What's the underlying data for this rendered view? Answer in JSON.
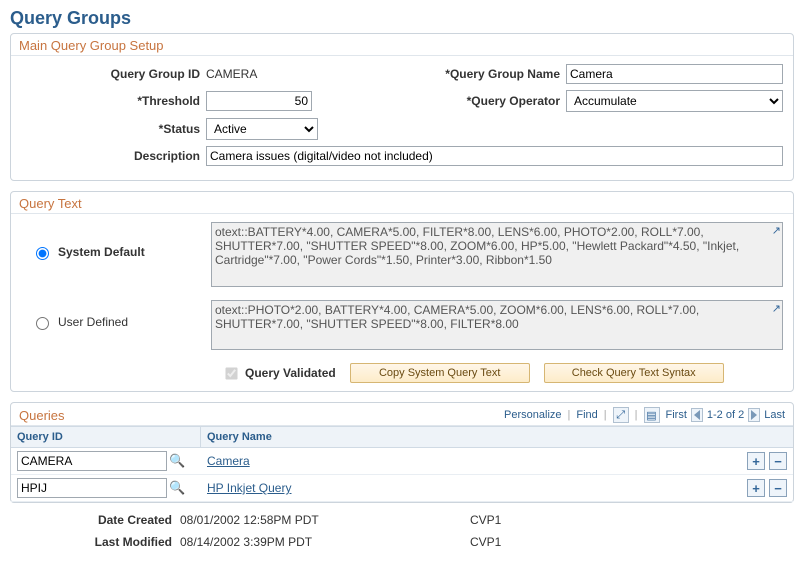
{
  "page": {
    "title": "Query Groups"
  },
  "main": {
    "section_title": "Main Query Group Setup",
    "labels": {
      "query_group_id": "Query Group ID",
      "threshold": "*Threshold",
      "status": "*Status",
      "description": "Description",
      "query_group_name": "*Query Group Name",
      "query_operator": "*Query Operator"
    },
    "values": {
      "query_group_id": "CAMERA",
      "threshold": "50",
      "status": "Active",
      "description": "Camera issues (digital/video not included)",
      "query_group_name": "Camera",
      "query_operator": "Accumulate"
    }
  },
  "query_text": {
    "section_title": "Query Text",
    "system_default_label": "System Default",
    "user_defined_label": "User Defined",
    "system_default_text": "otext::BATTERY*4.00, CAMERA*5.00, FILTER*8.00, LENS*6.00, PHOTO*2.00, ROLL*7.00, SHUTTER*7.00, \"SHUTTER SPEED\"*8.00, ZOOM*6.00, HP*5.00, \"Hewlett Packard\"*4.50, \"Inkjet, Cartridge\"*7.00, \"Power Cords\"*1.50, Printer*3.00, Ribbon*1.50",
    "user_defined_text": "otext::PHOTO*2.00, BATTERY*4.00, CAMERA*5.00, ZOOM*6.00, LENS*6.00, ROLL*7.00, SHUTTER*7.00, \"SHUTTER SPEED\"*8.00, FILTER*8.00",
    "query_validated_label": "Query Validated",
    "copy_button": "Copy System Query Text",
    "check_button": "Check Query Text Syntax"
  },
  "queries": {
    "section_title": "Queries",
    "toolbar": {
      "personalize": "Personalize",
      "find": "Find",
      "first": "First",
      "range": "1-2 of 2",
      "last": "Last"
    },
    "columns": {
      "id": "Query ID",
      "name": "Query Name"
    },
    "rows": [
      {
        "id": "CAMERA",
        "name": "Camera"
      },
      {
        "id": "HPIJ",
        "name": "HP Inkjet Query"
      }
    ]
  },
  "footer": {
    "date_created_label": "Date Created",
    "date_created_value": "08/01/2002 12:58PM PDT",
    "date_created_user": "CVP1",
    "last_modified_label": "Last Modified",
    "last_modified_value": "08/14/2002  3:39PM PDT",
    "last_modified_user": "CVP1"
  },
  "icons": {
    "lookup": "🔍",
    "expand": "↗",
    "plus": "+",
    "minus": "−",
    "zoom": "⤢",
    "grid": "▤"
  }
}
